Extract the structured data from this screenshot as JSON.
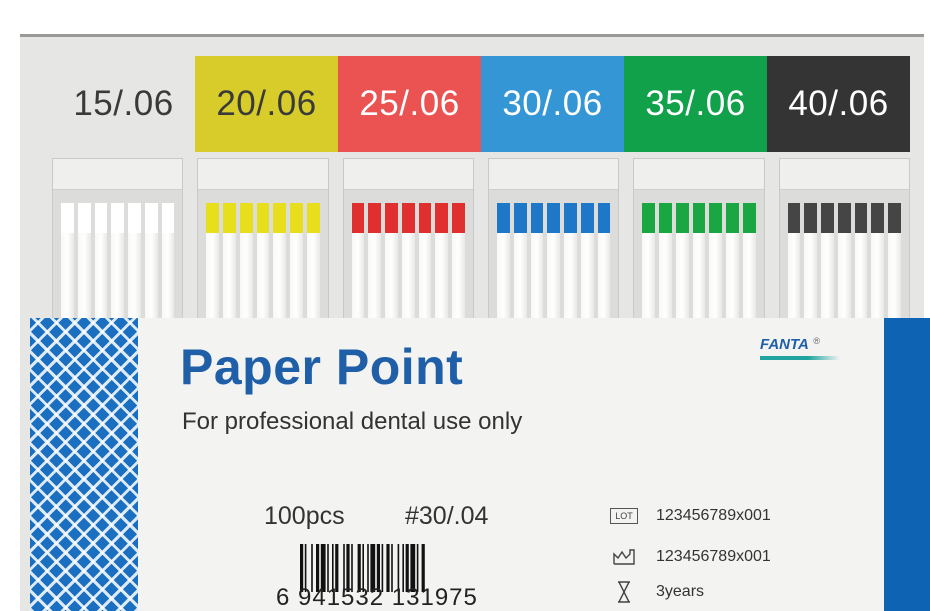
{
  "sizes": [
    {
      "label": "15/.06",
      "bg": "#e6e6e4",
      "fg": "#3a3a3a",
      "tip": "#ffffff"
    },
    {
      "label": "20/.06",
      "bg": "#d8cc2a",
      "fg": "#3a3a3a",
      "tip": "#e8df1c"
    },
    {
      "label": "25/.06",
      "bg": "#ea5352",
      "fg": "#ffffff",
      "tip": "#e02f2f"
    },
    {
      "label": "30/.06",
      "bg": "#3596d6",
      "fg": "#ffffff",
      "tip": "#1f78c7"
    },
    {
      "label": "35/.06",
      "bg": "#11a14a",
      "fg": "#ffffff",
      "tip": "#1aa640"
    },
    {
      "label": "40/.06",
      "bg": "#343434",
      "fg": "#ffffff",
      "tip": "#454545"
    }
  ],
  "product": {
    "title": "Paper Point",
    "subtitle": "For professional  dental use only",
    "brand": "FANTA",
    "brand_mark": "®",
    "count": "100pcs",
    "size_code": "#30/.04",
    "barcode_digits": "6  941532  131975"
  },
  "info": {
    "lot_icon": "lot-icon",
    "lot_icon_text": "LOT",
    "lot": "123456789x001",
    "mfg_icon": "manufacture-date-icon",
    "mfg": "123456789x001",
    "expiry_icon": "hourglass-icon",
    "expiry": "3years"
  },
  "colors": {
    "label_blue": "#1f5fa8",
    "band_blue": "#0f63b3"
  }
}
